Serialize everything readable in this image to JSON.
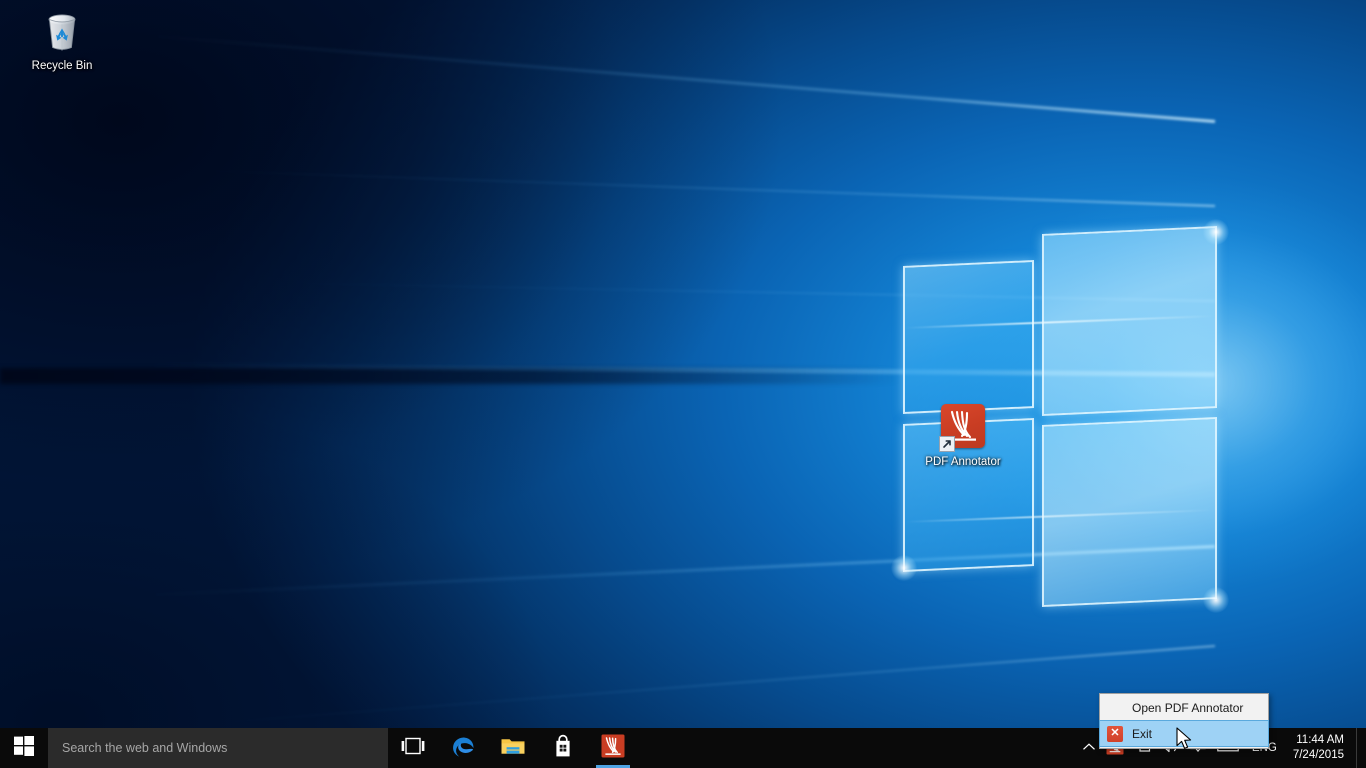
{
  "desktop": {
    "wallpaper_name": "windows-10-hero-wallpaper",
    "icons": [
      {
        "label": "Recycle Bin",
        "icon": "recycle-bin-icon"
      },
      {
        "label": "PDF Annotator",
        "icon": "pdf-annotator-icon"
      }
    ]
  },
  "taskbar": {
    "start_tooltip": "Start",
    "start_icon": "windows-logo-icon",
    "search": {
      "placeholder": "Search the web and Windows",
      "value": ""
    },
    "buttons": [
      {
        "label": "Task View",
        "icon": "task-view-icon",
        "active": false
      },
      {
        "label": "Microsoft Edge",
        "icon": "edge-icon",
        "active": false
      },
      {
        "label": "File Explorer",
        "icon": "file-explorer-icon",
        "active": false
      },
      {
        "label": "Store",
        "icon": "store-icon",
        "active": false
      },
      {
        "label": "PDF Annotator",
        "icon": "pdf-annotator-icon",
        "active": true
      }
    ],
    "tray": {
      "overflow_label": "Show hidden icons",
      "overflow_icon": "chevron-up-icon",
      "items": [
        {
          "label": "PDF Annotator",
          "icon": "pdf-annotator-tray-icon"
        },
        {
          "label": "Network",
          "icon": "network-icon"
        },
        {
          "label": "Volume",
          "icon": "speaker-icon"
        },
        {
          "label": "Action Center",
          "icon": "action-center-icon"
        },
        {
          "label": "Touch Keyboard",
          "icon": "keyboard-icon"
        }
      ],
      "language": "ENG"
    },
    "clock": {
      "time": "11:44 AM",
      "date": "7/24/2015"
    },
    "show_desktop_label": "Show desktop"
  },
  "context_menu": {
    "items": [
      {
        "label": "Open PDF Annotator",
        "icon": "none",
        "highlighted": false
      },
      {
        "label": "Exit",
        "icon": "close-x-icon",
        "highlighted": true
      }
    ]
  },
  "colors": {
    "taskbar_bg": "#0a0a0a",
    "search_bg": "#2b2b2b",
    "accent_blue": "#4ea3e3",
    "menu_bg": "#f2f2f2",
    "menu_highlight": "#9ed2f5",
    "app_red": "#c93d23",
    "exit_red": "#d0412a"
  }
}
